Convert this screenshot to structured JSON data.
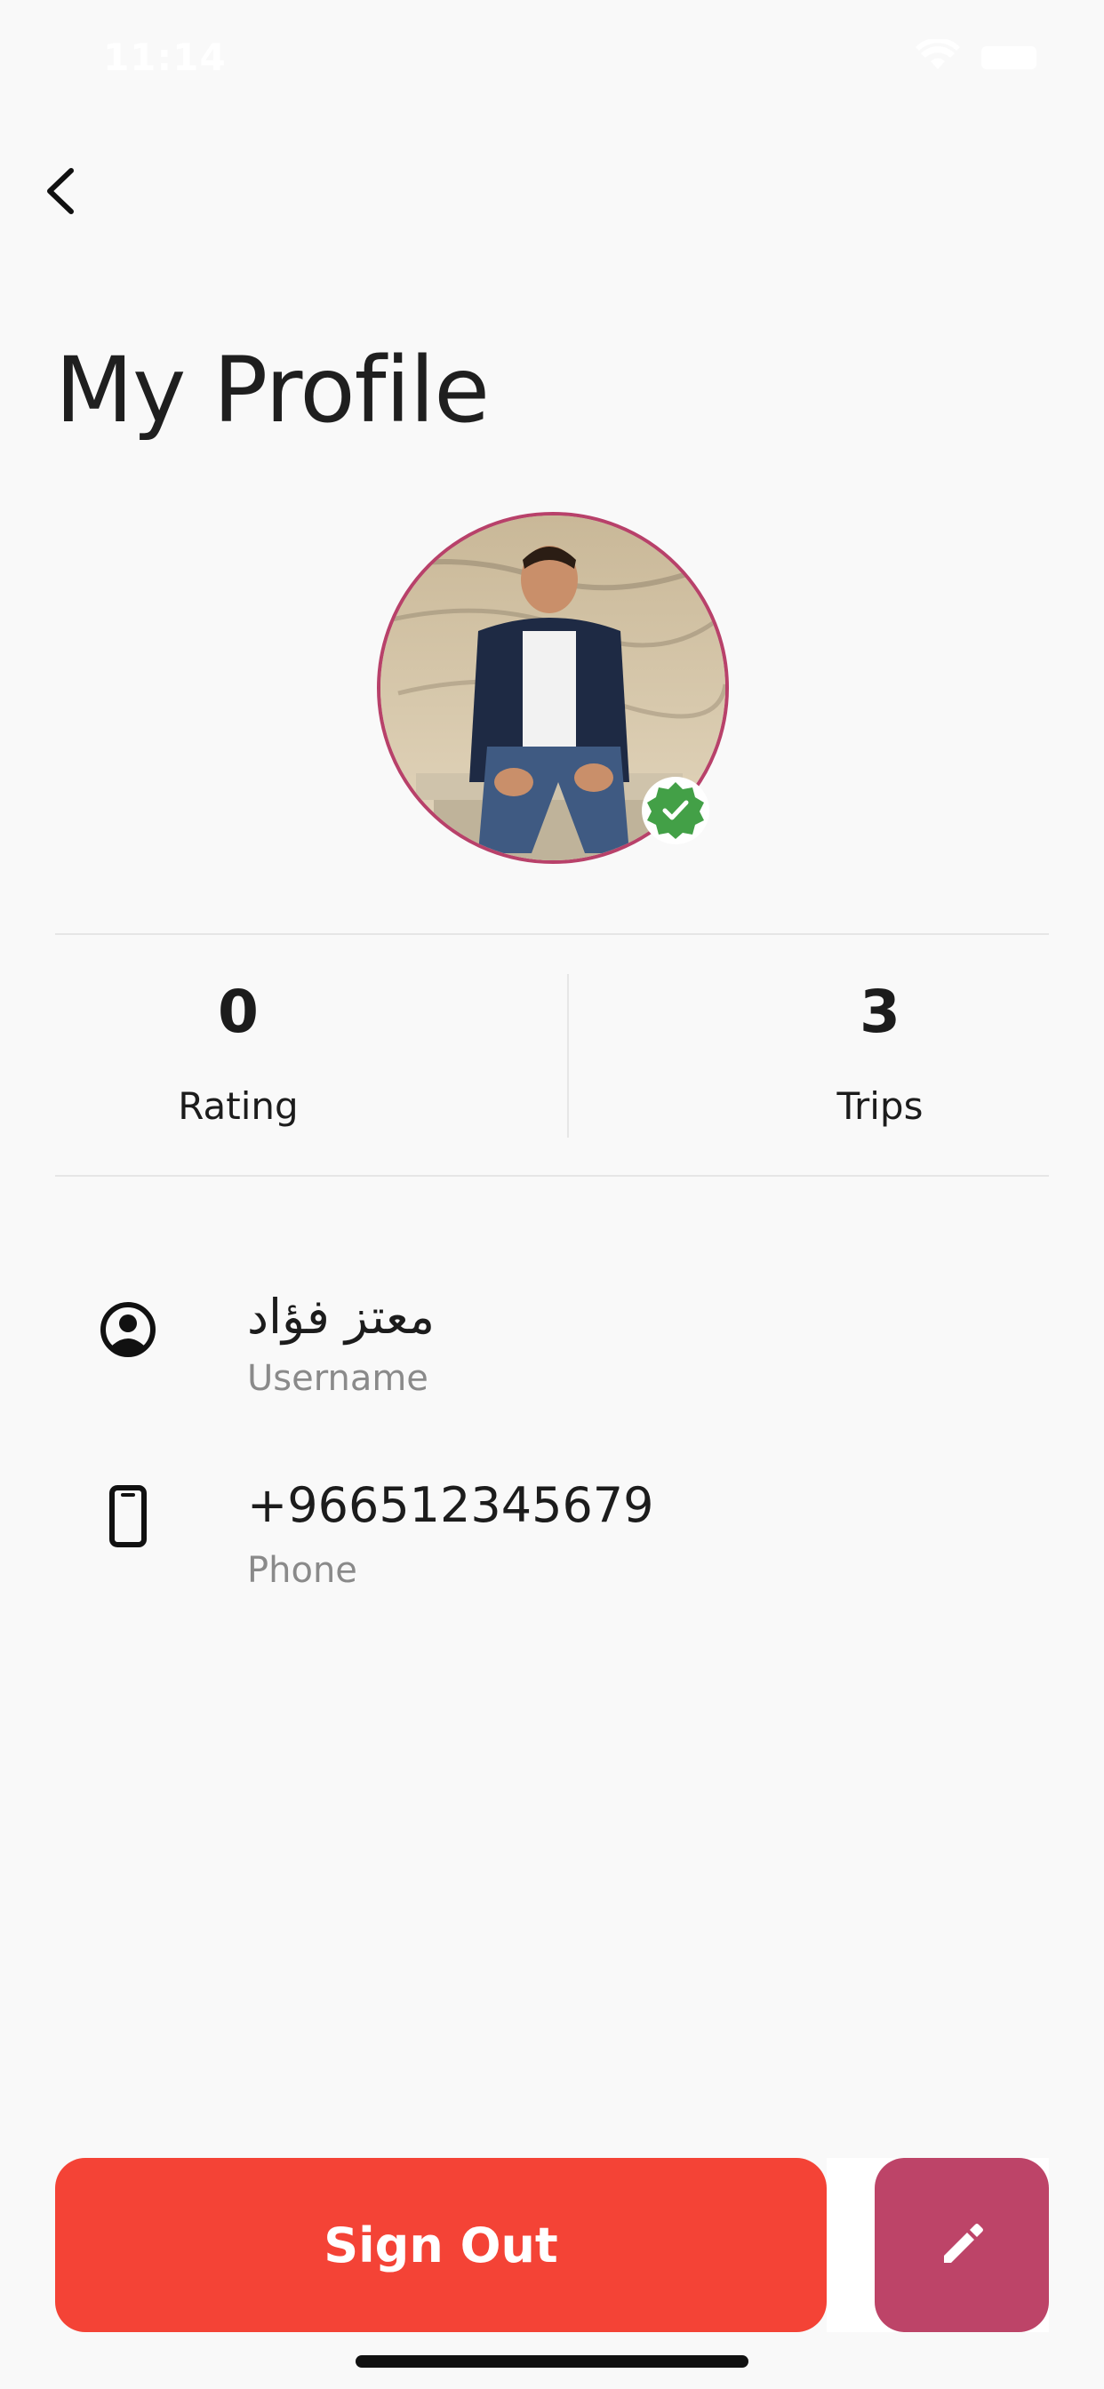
{
  "status_bar": {
    "time": "11:14"
  },
  "header": {
    "title": "My Profile"
  },
  "profile": {
    "verified": true,
    "accent_color": "#b8416a",
    "verified_color": "#43a047"
  },
  "stats": [
    {
      "value": "0",
      "label": "Rating"
    },
    {
      "value": "3",
      "label": "Trips"
    }
  ],
  "info": {
    "username": {
      "value": "معتز فؤاد",
      "label": "Username",
      "icon": "account-circle-icon"
    },
    "phone": {
      "value": "+966512345679",
      "label": "Phone",
      "icon": "smartphone-icon"
    }
  },
  "actions": {
    "signout_label": "Sign Out",
    "signout_color": "#f44336",
    "edit_icon": "pencil-icon",
    "edit_color": "#bd4468"
  }
}
